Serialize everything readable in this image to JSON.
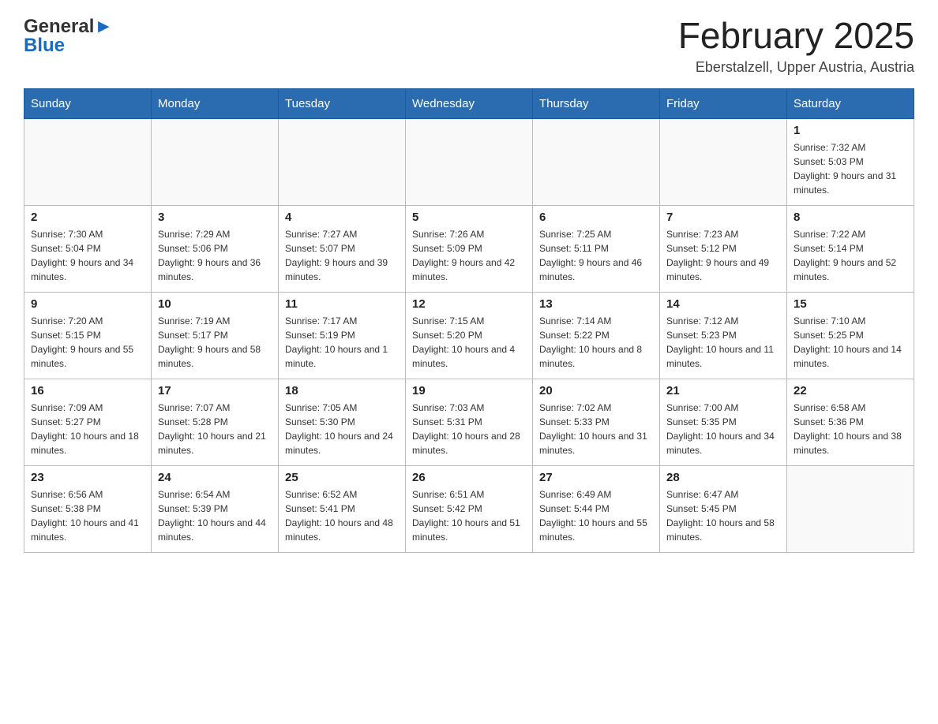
{
  "logo": {
    "general": "General",
    "blue": "Blue"
  },
  "header": {
    "month_title": "February 2025",
    "location": "Eberstalzell, Upper Austria, Austria"
  },
  "days_of_week": [
    "Sunday",
    "Monday",
    "Tuesday",
    "Wednesday",
    "Thursday",
    "Friday",
    "Saturday"
  ],
  "weeks": [
    [
      {
        "day": "",
        "sunrise": "",
        "sunset": "",
        "daylight": ""
      },
      {
        "day": "",
        "sunrise": "",
        "sunset": "",
        "daylight": ""
      },
      {
        "day": "",
        "sunrise": "",
        "sunset": "",
        "daylight": ""
      },
      {
        "day": "",
        "sunrise": "",
        "sunset": "",
        "daylight": ""
      },
      {
        "day": "",
        "sunrise": "",
        "sunset": "",
        "daylight": ""
      },
      {
        "day": "",
        "sunrise": "",
        "sunset": "",
        "daylight": ""
      },
      {
        "day": "1",
        "sunrise": "Sunrise: 7:32 AM",
        "sunset": "Sunset: 5:03 PM",
        "daylight": "Daylight: 9 hours and 31 minutes."
      }
    ],
    [
      {
        "day": "2",
        "sunrise": "Sunrise: 7:30 AM",
        "sunset": "Sunset: 5:04 PM",
        "daylight": "Daylight: 9 hours and 34 minutes."
      },
      {
        "day": "3",
        "sunrise": "Sunrise: 7:29 AM",
        "sunset": "Sunset: 5:06 PM",
        "daylight": "Daylight: 9 hours and 36 minutes."
      },
      {
        "day": "4",
        "sunrise": "Sunrise: 7:27 AM",
        "sunset": "Sunset: 5:07 PM",
        "daylight": "Daylight: 9 hours and 39 minutes."
      },
      {
        "day": "5",
        "sunrise": "Sunrise: 7:26 AM",
        "sunset": "Sunset: 5:09 PM",
        "daylight": "Daylight: 9 hours and 42 minutes."
      },
      {
        "day": "6",
        "sunrise": "Sunrise: 7:25 AM",
        "sunset": "Sunset: 5:11 PM",
        "daylight": "Daylight: 9 hours and 46 minutes."
      },
      {
        "day": "7",
        "sunrise": "Sunrise: 7:23 AM",
        "sunset": "Sunset: 5:12 PM",
        "daylight": "Daylight: 9 hours and 49 minutes."
      },
      {
        "day": "8",
        "sunrise": "Sunrise: 7:22 AM",
        "sunset": "Sunset: 5:14 PM",
        "daylight": "Daylight: 9 hours and 52 minutes."
      }
    ],
    [
      {
        "day": "9",
        "sunrise": "Sunrise: 7:20 AM",
        "sunset": "Sunset: 5:15 PM",
        "daylight": "Daylight: 9 hours and 55 minutes."
      },
      {
        "day": "10",
        "sunrise": "Sunrise: 7:19 AM",
        "sunset": "Sunset: 5:17 PM",
        "daylight": "Daylight: 9 hours and 58 minutes."
      },
      {
        "day": "11",
        "sunrise": "Sunrise: 7:17 AM",
        "sunset": "Sunset: 5:19 PM",
        "daylight": "Daylight: 10 hours and 1 minute."
      },
      {
        "day": "12",
        "sunrise": "Sunrise: 7:15 AM",
        "sunset": "Sunset: 5:20 PM",
        "daylight": "Daylight: 10 hours and 4 minutes."
      },
      {
        "day": "13",
        "sunrise": "Sunrise: 7:14 AM",
        "sunset": "Sunset: 5:22 PM",
        "daylight": "Daylight: 10 hours and 8 minutes."
      },
      {
        "day": "14",
        "sunrise": "Sunrise: 7:12 AM",
        "sunset": "Sunset: 5:23 PM",
        "daylight": "Daylight: 10 hours and 11 minutes."
      },
      {
        "day": "15",
        "sunrise": "Sunrise: 7:10 AM",
        "sunset": "Sunset: 5:25 PM",
        "daylight": "Daylight: 10 hours and 14 minutes."
      }
    ],
    [
      {
        "day": "16",
        "sunrise": "Sunrise: 7:09 AM",
        "sunset": "Sunset: 5:27 PM",
        "daylight": "Daylight: 10 hours and 18 minutes."
      },
      {
        "day": "17",
        "sunrise": "Sunrise: 7:07 AM",
        "sunset": "Sunset: 5:28 PM",
        "daylight": "Daylight: 10 hours and 21 minutes."
      },
      {
        "day": "18",
        "sunrise": "Sunrise: 7:05 AM",
        "sunset": "Sunset: 5:30 PM",
        "daylight": "Daylight: 10 hours and 24 minutes."
      },
      {
        "day": "19",
        "sunrise": "Sunrise: 7:03 AM",
        "sunset": "Sunset: 5:31 PM",
        "daylight": "Daylight: 10 hours and 28 minutes."
      },
      {
        "day": "20",
        "sunrise": "Sunrise: 7:02 AM",
        "sunset": "Sunset: 5:33 PM",
        "daylight": "Daylight: 10 hours and 31 minutes."
      },
      {
        "day": "21",
        "sunrise": "Sunrise: 7:00 AM",
        "sunset": "Sunset: 5:35 PM",
        "daylight": "Daylight: 10 hours and 34 minutes."
      },
      {
        "day": "22",
        "sunrise": "Sunrise: 6:58 AM",
        "sunset": "Sunset: 5:36 PM",
        "daylight": "Daylight: 10 hours and 38 minutes."
      }
    ],
    [
      {
        "day": "23",
        "sunrise": "Sunrise: 6:56 AM",
        "sunset": "Sunset: 5:38 PM",
        "daylight": "Daylight: 10 hours and 41 minutes."
      },
      {
        "day": "24",
        "sunrise": "Sunrise: 6:54 AM",
        "sunset": "Sunset: 5:39 PM",
        "daylight": "Daylight: 10 hours and 44 minutes."
      },
      {
        "day": "25",
        "sunrise": "Sunrise: 6:52 AM",
        "sunset": "Sunset: 5:41 PM",
        "daylight": "Daylight: 10 hours and 48 minutes."
      },
      {
        "day": "26",
        "sunrise": "Sunrise: 6:51 AM",
        "sunset": "Sunset: 5:42 PM",
        "daylight": "Daylight: 10 hours and 51 minutes."
      },
      {
        "day": "27",
        "sunrise": "Sunrise: 6:49 AM",
        "sunset": "Sunset: 5:44 PM",
        "daylight": "Daylight: 10 hours and 55 minutes."
      },
      {
        "day": "28",
        "sunrise": "Sunrise: 6:47 AM",
        "sunset": "Sunset: 5:45 PM",
        "daylight": "Daylight: 10 hours and 58 minutes."
      },
      {
        "day": "",
        "sunrise": "",
        "sunset": "",
        "daylight": ""
      }
    ]
  ]
}
